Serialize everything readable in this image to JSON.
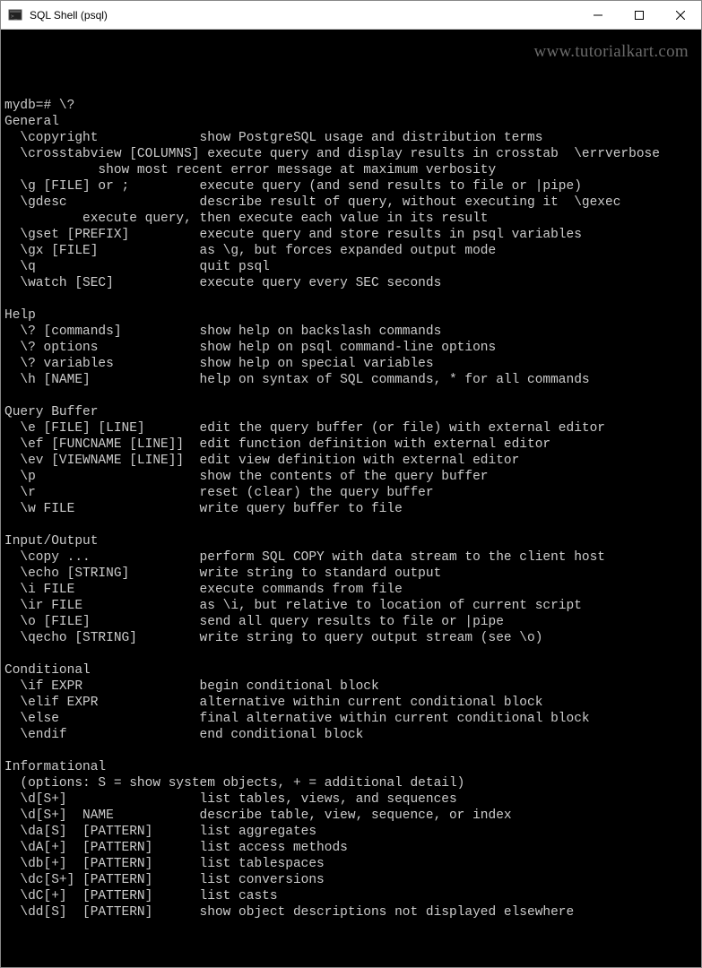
{
  "window": {
    "title": "SQL Shell (psql)"
  },
  "watermark": "www.tutorialkart.com",
  "prompt": "mydb=# \\?",
  "sections": [
    {
      "title": "General",
      "items": [
        {
          "cmd": "  \\copyright",
          "desc": "show PostgreSQL usage and distribution terms"
        },
        {
          "cmd": "  \\crosstabview [COLUMNS]",
          "desc": "execute query and display results in crosstab  \\errverbose",
          "nogap": true
        },
        {
          "cmd": "",
          "desc": "show most recent error message at maximum verbosity",
          "descpad": "            "
        },
        {
          "cmd": "  \\g [FILE] or ;",
          "desc": "execute query (and send results to file or |pipe)"
        },
        {
          "cmd": "  \\gdesc",
          "desc": "describe result of query, without executing it  \\gexec"
        },
        {
          "cmd": "",
          "desc": "execute query, then execute each value in its result",
          "descpad": "          "
        },
        {
          "cmd": "  \\gset [PREFIX]",
          "desc": "execute query and store results in psql variables"
        },
        {
          "cmd": "  \\gx [FILE]",
          "desc": "as \\g, but forces expanded output mode"
        },
        {
          "cmd": "  \\q",
          "desc": "quit psql"
        },
        {
          "cmd": "  \\watch [SEC]",
          "desc": "execute query every SEC seconds"
        }
      ]
    },
    {
      "title": "Help",
      "items": [
        {
          "cmd": "  \\? [commands]",
          "desc": "show help on backslash commands"
        },
        {
          "cmd": "  \\? options",
          "desc": "show help on psql command-line options"
        },
        {
          "cmd": "  \\? variables",
          "desc": "show help on special variables"
        },
        {
          "cmd": "  \\h [NAME]",
          "desc": "help on syntax of SQL commands, * for all commands"
        }
      ]
    },
    {
      "title": "Query Buffer",
      "items": [
        {
          "cmd": "  \\e [FILE] [LINE]",
          "desc": "edit the query buffer (or file) with external editor"
        },
        {
          "cmd": "  \\ef [FUNCNAME [LINE]]",
          "desc": "edit function definition with external editor"
        },
        {
          "cmd": "  \\ev [VIEWNAME [LINE]]",
          "desc": "edit view definition with external editor"
        },
        {
          "cmd": "  \\p",
          "desc": "show the contents of the query buffer"
        },
        {
          "cmd": "  \\r",
          "desc": "reset (clear) the query buffer"
        },
        {
          "cmd": "  \\w FILE",
          "desc": "write query buffer to file"
        }
      ]
    },
    {
      "title": "Input/Output",
      "items": [
        {
          "cmd": "  \\copy ...",
          "desc": "perform SQL COPY with data stream to the client host"
        },
        {
          "cmd": "  \\echo [STRING]",
          "desc": "write string to standard output"
        },
        {
          "cmd": "  \\i FILE",
          "desc": "execute commands from file"
        },
        {
          "cmd": "  \\ir FILE",
          "desc": "as \\i, but relative to location of current script"
        },
        {
          "cmd": "  \\o [FILE]",
          "desc": "send all query results to file or |pipe"
        },
        {
          "cmd": "  \\qecho [STRING]",
          "desc": "write string to query output stream (see \\o)"
        }
      ]
    },
    {
      "title": "Conditional",
      "items": [
        {
          "cmd": "  \\if EXPR",
          "desc": "begin conditional block"
        },
        {
          "cmd": "  \\elif EXPR",
          "desc": "alternative within current conditional block"
        },
        {
          "cmd": "  \\else",
          "desc": "final alternative within current conditional block"
        },
        {
          "cmd": "  \\endif",
          "desc": "end conditional block"
        }
      ]
    },
    {
      "title": "Informational",
      "note": "  (options: S = show system objects, + = additional detail)",
      "items": [
        {
          "cmd": "  \\d[S+]",
          "desc": "list tables, views, and sequences"
        },
        {
          "cmd": "  \\d[S+]  NAME",
          "desc": "describe table, view, sequence, or index"
        },
        {
          "cmd": "  \\da[S]  [PATTERN]",
          "desc": "list aggregates"
        },
        {
          "cmd": "  \\dA[+]  [PATTERN]",
          "desc": "list access methods"
        },
        {
          "cmd": "  \\db[+]  [PATTERN]",
          "desc": "list tablespaces"
        },
        {
          "cmd": "  \\dc[S+] [PATTERN]",
          "desc": "list conversions"
        },
        {
          "cmd": "  \\dC[+]  [PATTERN]",
          "desc": "list casts"
        },
        {
          "cmd": "  \\dd[S]  [PATTERN]",
          "desc": "show object descriptions not displayed elsewhere"
        }
      ]
    }
  ],
  "layout": {
    "cmd_col_width": 25
  }
}
